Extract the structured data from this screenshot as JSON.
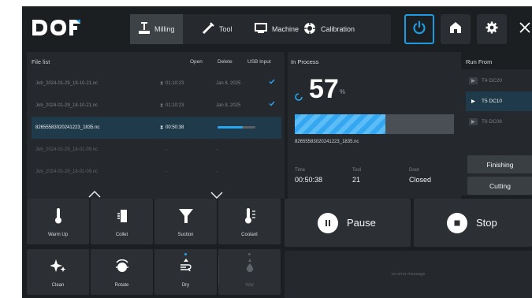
{
  "brand": {
    "logo_text": "DOF",
    "accent": "#1e9be0"
  },
  "topbar": {
    "modes": [
      {
        "label": "Milling",
        "icon": "milling-icon",
        "active": true
      },
      {
        "label": "Tool",
        "icon": "tool-icon",
        "active": false
      },
      {
        "label": "Machine",
        "icon": "machine-icon",
        "active": false
      },
      {
        "label": "Calibration",
        "icon": "calibration-icon",
        "active": false
      }
    ],
    "actions": [
      "power-icon",
      "home-icon",
      "gear-icon",
      "close-icon"
    ]
  },
  "file_list": {
    "title": "File list",
    "columns": [
      "Open",
      "Delete",
      "USB Input"
    ],
    "rows": [
      {
        "name": "Job_2024-01-29_18-10-21.nc",
        "time": "01:10:23",
        "date": "Jan 8, 2025",
        "done": true,
        "state": "normal"
      },
      {
        "name": "Job_2024-01-29_18-10-21.nc",
        "time": "01:10:23",
        "date": "Jan 8, 2025",
        "done": true,
        "state": "normal"
      },
      {
        "name": "82655583020241223_1835.nc",
        "time": "00:50:38",
        "date": "",
        "done": false,
        "state": "selected",
        "progress": 0.67
      },
      {
        "name": "Job_2024-01-29_18-01-09.nc",
        "time": "-",
        "date": "-",
        "done": false,
        "state": "dim"
      },
      {
        "name": "Job_2024-01-29_18-01-09.nc",
        "time": "-",
        "date": "-",
        "done": false,
        "state": "dim"
      }
    ]
  },
  "in_process": {
    "title": "In Process",
    "percent": "57",
    "percent_unit": "%",
    "progress": 0.57,
    "file": "82655583020241223_1835.nc",
    "stats": [
      {
        "label": "Time",
        "value": "00:50:38"
      },
      {
        "label": "Tool",
        "value": "21"
      },
      {
        "label": "Door",
        "value": "Closed"
      }
    ]
  },
  "run_from": {
    "title": "Run From",
    "items": [
      {
        "label": "T4 DC20",
        "active": false
      },
      {
        "label": "T5 DC10",
        "active": true
      },
      {
        "label": "T6 DC06",
        "active": false
      }
    ],
    "buttons": [
      "Finishing",
      "Cutting"
    ]
  },
  "tools": [
    {
      "label": "Warm Up",
      "icon": "thermometer-icon",
      "disabled": false
    },
    {
      "label": "Collet",
      "icon": "collet-icon",
      "disabled": false
    },
    {
      "label": "Suction",
      "icon": "suction-icon",
      "disabled": false
    },
    {
      "label": "Coolant",
      "icon": "coolant-icon",
      "disabled": false
    },
    {
      "label": "Clean",
      "icon": "sparkle-icon",
      "disabled": false
    },
    {
      "label": "Rotate",
      "icon": "rotate-icon",
      "disabled": false
    },
    {
      "label": "Dry",
      "icon": "dry-icon",
      "disabled": false
    },
    {
      "label": "Wet",
      "icon": "wet-icon",
      "disabled": true
    }
  ],
  "controls": {
    "pause_label": "Pause",
    "stop_label": "Stop"
  },
  "messages": {
    "text": "no error message"
  }
}
